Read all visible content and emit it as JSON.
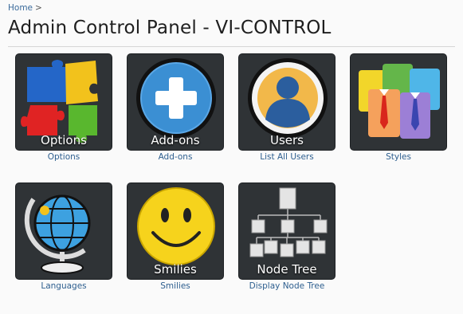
{
  "breadcrumb": {
    "home": "Home",
    "separator": ">"
  },
  "title": "Admin Control Panel - VI-CONTROL",
  "tiles": [
    {
      "id": "options",
      "overlay": "Options",
      "caption": "Options",
      "icon": "puzzle-icon"
    },
    {
      "id": "addons",
      "overlay": "Add-ons",
      "caption": "Add-ons",
      "icon": "plus-icon"
    },
    {
      "id": "users",
      "overlay": "Users",
      "caption": "List All Users",
      "icon": "user-icon"
    },
    {
      "id": "styles",
      "overlay": "",
      "caption": "Styles",
      "icon": "shirts-icon"
    },
    {
      "id": "languages",
      "overlay": "",
      "caption": "Languages",
      "icon": "globe-icon"
    },
    {
      "id": "smilies",
      "overlay": "Smilies",
      "caption": "Smilies",
      "icon": "smiley-icon"
    },
    {
      "id": "nodetree",
      "overlay": "Node Tree",
      "caption": "Display Node Tree",
      "icon": "node-tree-icon"
    }
  ]
}
